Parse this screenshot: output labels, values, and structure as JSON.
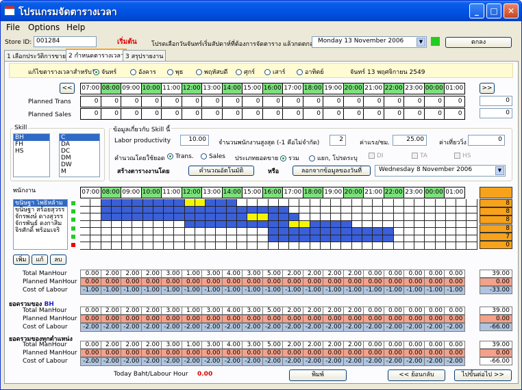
{
  "window": {
    "title": "โปรแกรมจัดตารางเวลา",
    "min": "_",
    "max": "□",
    "close": "✕"
  },
  "menu": [
    "File",
    "Options",
    "Help"
  ],
  "top": {
    "store_label": "Store ID:",
    "store_value": "001284",
    "start_label": "เริ่มต้น",
    "instruction": "โปรดเลือกวันจันทร์เริ่มสัปดาห์ที่ต้องการจัดตาราง แล้วกดตกลง",
    "date": "Monday    13 November  2006",
    "ok": "ตกลง",
    "status_color": "#22cc22"
  },
  "tabs": [
    "1 เลือกประวัติการขาย",
    "2 กำหนดตารางเวลา",
    "3 สรุปรายงาน"
  ],
  "daybar": {
    "label": "แก้ไขตารางเวลาสำหรับวัน",
    "days": [
      "จันทร์",
      "อังคาร",
      "พุธ",
      "พฤหัสบดี",
      "ศุกร์",
      "เสาร์",
      "อาทิตย์"
    ],
    "selected": 0,
    "thai_date": "จันทร์ 13 พฤศจิกายน 2549"
  },
  "hours": [
    "07:00",
    "08:00",
    "09:00",
    "10:00",
    "11:00",
    "12:00",
    "13:00",
    "14:00",
    "15:00",
    "16:00",
    "17:00",
    "18:00",
    "19:00",
    "20:00",
    "21:00",
    "22:00",
    "23:00",
    "00:00",
    "01:00"
  ],
  "hour_green": [
    false,
    true,
    false,
    true,
    false,
    true,
    false,
    true,
    false,
    true,
    false,
    true,
    false,
    true,
    false,
    true,
    false,
    true,
    false
  ],
  "nav": {
    "prev": "<<",
    "next": ">>"
  },
  "planned": {
    "trans_label": "Planned Trans",
    "sales_label": "Planned Sales",
    "trans": [
      "0",
      "0",
      "0",
      "0",
      "0",
      "0",
      "0",
      "0",
      "0",
      "0",
      "0",
      "0",
      "0",
      "0",
      "0",
      "0",
      "0",
      "0",
      "0"
    ],
    "sales": [
      "0",
      "0",
      "0",
      "0",
      "0",
      "0",
      "0",
      "0",
      "0",
      "0",
      "0",
      "0",
      "0",
      "0",
      "0",
      "0",
      "0",
      "0",
      "0"
    ],
    "trans_total": "0",
    "sales_total": "0"
  },
  "skill": {
    "label": "Skill",
    "left": [
      "BH",
      "FH",
      "HS"
    ],
    "left_selected": 0,
    "right": [
      "C",
      "DA",
      "DC",
      "DM",
      "DW",
      "M"
    ],
    "right_selected": 0
  },
  "skillinfo": {
    "title": "ข้อมูลเกี่ยวกับ Skill นี้",
    "productivity_label": "Labor productivity",
    "productivity": "10.00",
    "maxstaff_label": "จำนวนพนักงานสูงสุด (-1 คือไม่จำกัด)",
    "maxstaff": "2",
    "wage_label": "ค่าแรง/ชม.",
    "wage": "25.00",
    "travel_label": "ค่าเที่ยววิ่ง",
    "travel": "0",
    "calc_label": "คำนวณโดยใช้ยอด",
    "calc_trans": "Trans.",
    "calc_sales": "Sales",
    "type_label": "ประเภทยอดขาย",
    "type_total": "รวม",
    "type_split": "แยก, โปรดระบุ",
    "cb_di": "DI",
    "cb_ta": "TA",
    "cb_hs": "HS",
    "create_label": "สร้างตารางงานโดย",
    "auto_btn": "คำนวณอัตโนมัติ",
    "or": "หรือ",
    "copy_btn": "ลอกจากข้อมูลของวันที่",
    "copy_date": "Wednesday   8 November  2006"
  },
  "staff": {
    "label": "พนักงาน",
    "names": [
      "ขนิษฐา โพธิ์หล้าม",
      "ขนิษฐา สร้อยสุวรร",
      "จักรพงษ์ ดางสุวรร",
      "จักรพันธ์ ดงกาสิม",
      "จิรศักดิ์ พร้อมเจริ"
    ],
    "totals": [
      "8",
      "8",
      "8",
      "8",
      "7",
      "0"
    ],
    "status_colors": [
      "#22cc22",
      "#22cc22",
      "#22cc22",
      "#22cc22",
      "#22cc22",
      "#ee0000"
    ],
    "add": "เพิ่ม",
    "edit": "แก้",
    "delete": "ลบ"
  },
  "summary_labels": {
    "total": "Total ManHour",
    "planned": "Planned ManHour",
    "cost": "Cost of Labour",
    "bh_title": "ยอดรวมของ",
    "bh_skill": "BH",
    "all_title": "ยอดรวมของทุกตำแหน่ง"
  },
  "summary": {
    "total": [
      "0.00",
      "2.00",
      "2.00",
      "2.00",
      "3.00",
      "1.00",
      "3.00",
      "4.00",
      "3.00",
      "5.00",
      "2.00",
      "2.00",
      "2.00",
      "2.00",
      "0.00",
      "0.00",
      "0.00",
      "0.00",
      "0.00"
    ],
    "planned": [
      "0.00",
      "0.00",
      "0.00",
      "0.00",
      "0.00",
      "0.00",
      "0.00",
      "0.00",
      "0.00",
      "0.00",
      "0.00",
      "0.00",
      "0.00",
      "0.00",
      "0.00",
      "0.00",
      "0.00",
      "0.00",
      "0.00"
    ],
    "cost1": [
      "-1.00",
      "-1.00",
      "-1.00",
      "-1.00",
      "-1.00",
      "-1.00",
      "-1.00",
      "-1.00",
      "-1.00",
      "-1.00",
      "-1.00",
      "-1.00",
      "-1.00",
      "-1.00",
      "-1.00",
      "-1.00",
      "-1.00",
      "-1.00",
      "-1.00"
    ],
    "cost2": [
      "-2.00",
      "-2.00",
      "-2.00",
      "-2.00",
      "-2.00",
      "-2.00",
      "-2.00",
      "-2.00",
      "-2.00",
      "-2.00",
      "-2.00",
      "-2.00",
      "-2.00",
      "-2.00",
      "-2.00",
      "-2.00",
      "-2.00",
      "-2.00",
      "-2.00"
    ],
    "tot_total": "39.00",
    "tot_planned": "0.00",
    "tot_cost1": "-33.00",
    "tot_cost2": "-66.00"
  },
  "footer": {
    "baht_label": "Today Baht/Labour Hour",
    "baht_value": "0.00",
    "print": "พิมพ์",
    "back": "<< ย้อนกลับ",
    "next": "ไปขั้นต่อไป >>"
  }
}
